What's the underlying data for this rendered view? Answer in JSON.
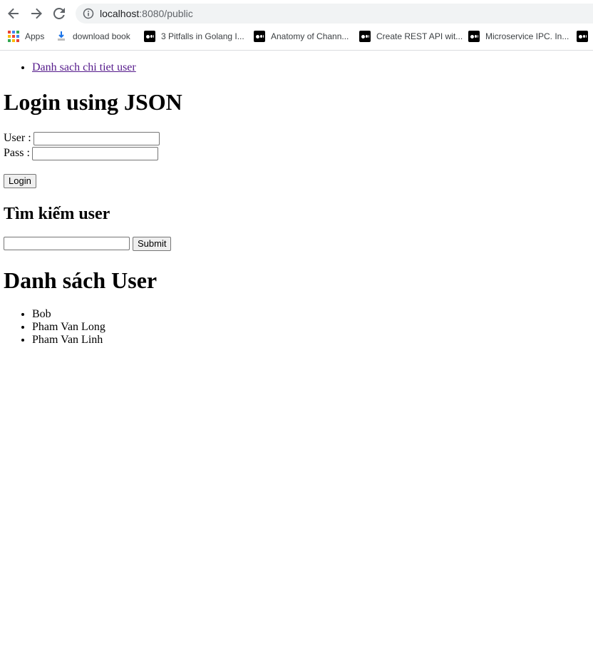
{
  "browser": {
    "url_host": "localhost",
    "url_path": ":8080/public"
  },
  "bookmarks": [
    {
      "icon": "apps-icon",
      "label": "Apps"
    },
    {
      "icon": "bookmark-favicon",
      "label": "download book"
    },
    {
      "icon": "medium-icon",
      "label": "3 Pitfalls in Golang I..."
    },
    {
      "icon": "medium-icon",
      "label": "Anatomy of Chann..."
    },
    {
      "icon": "medium-icon",
      "label": "Create REST API wit..."
    },
    {
      "icon": "medium-icon",
      "label": "Microservice IPC. In..."
    },
    {
      "icon": "medium-icon",
      "label": ""
    }
  ],
  "page": {
    "nav_link": "Danh sach chi tiet user",
    "login_heading": "Login using JSON",
    "user_label": "User :",
    "pass_label": "Pass :",
    "login_button": "Login",
    "search_heading": "Tìm kiếm user",
    "submit_button": "Submit",
    "users_heading": "Danh sách User",
    "users": [
      "Bob",
      "Pham Van Long",
      "Pham Van Linh"
    ]
  }
}
